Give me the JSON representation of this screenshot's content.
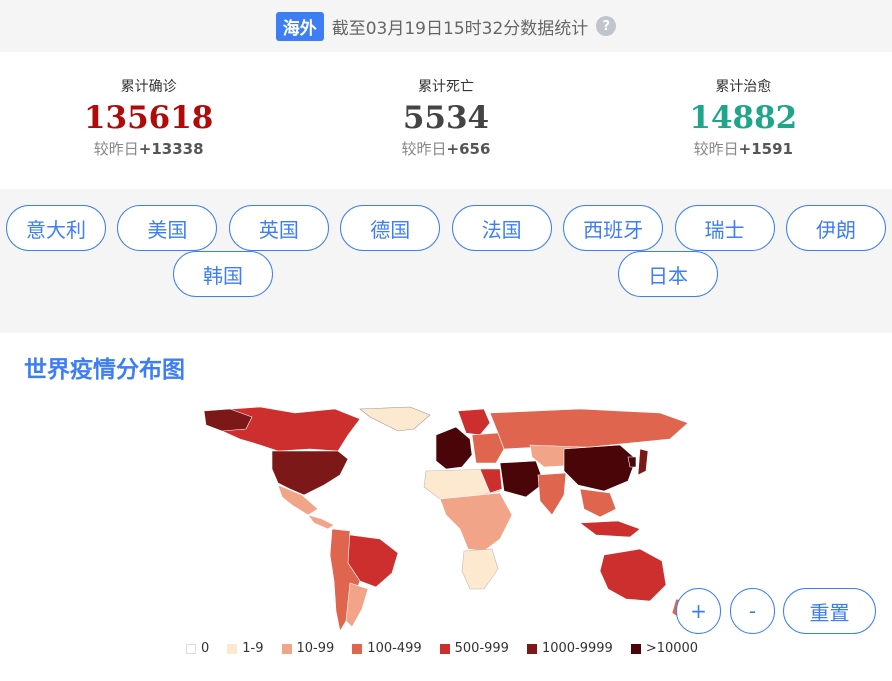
{
  "header": {
    "tag": "海外",
    "text": "截至03月19日15时32分数据统计",
    "help_glyph": "?"
  },
  "stats": [
    {
      "label": "累计确诊",
      "value": "135618",
      "delta_prefix": "较昨日",
      "delta": "+13338",
      "color": "#b00a0a"
    },
    {
      "label": "累计死亡",
      "value": "5534",
      "delta_prefix": "较昨日",
      "delta": "+656",
      "color": "#444444"
    },
    {
      "label": "累计治愈",
      "value": "14882",
      "delta_prefix": "较昨日",
      "delta": "+1591",
      "color": "#1fa58a"
    }
  ],
  "countries": [
    "意大利",
    "美国",
    "英国",
    "德国",
    "法国",
    "西班牙",
    "瑞士",
    "伊朗",
    "韩国",
    "日本"
  ],
  "map": {
    "title": "世界疫情分布图",
    "legend": [
      {
        "label": "0",
        "color": "#ffffff"
      },
      {
        "label": "1-9",
        "color": "#fde9cf"
      },
      {
        "label": "10-99",
        "color": "#f2a489"
      },
      {
        "label": "100-499",
        "color": "#e0654f"
      },
      {
        "label": "500-999",
        "color": "#cc2f2d"
      },
      {
        "label": "1000-9999",
        "color": "#7d1818"
      },
      {
        "label": ">10000",
        "color": "#4a0508"
      }
    ],
    "controls": {
      "zoom_in": "+",
      "zoom_out": "-",
      "reset": "重置"
    }
  }
}
